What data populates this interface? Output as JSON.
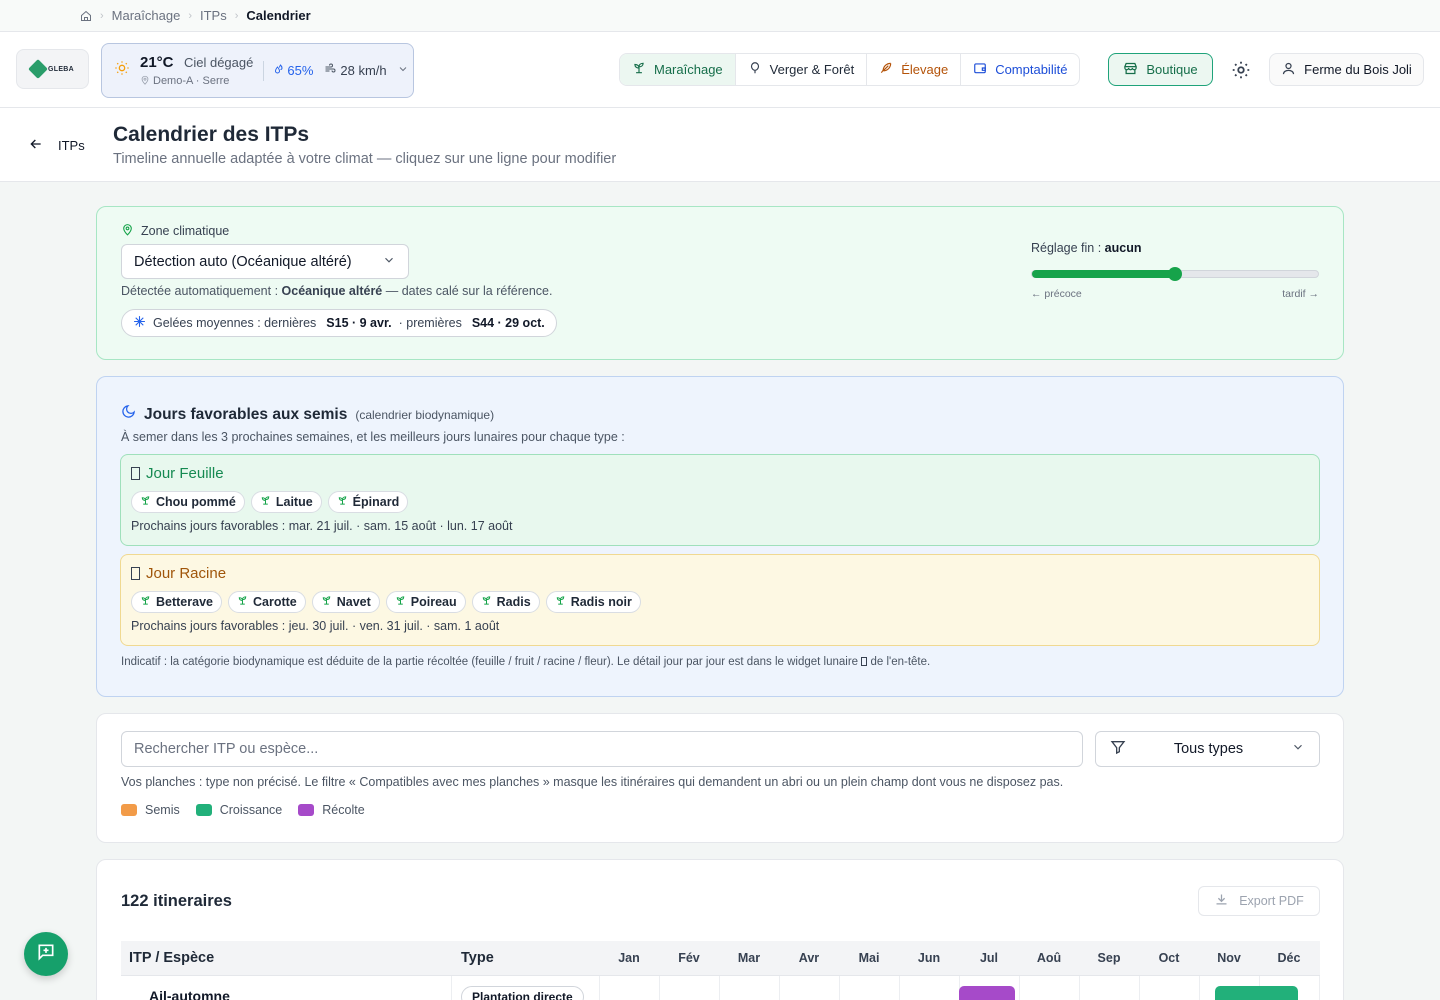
{
  "breadcrumb": {
    "items": [
      "Maraîchage",
      "ITPs"
    ],
    "current": "Calendrier"
  },
  "weather": {
    "temp": "21°C",
    "condition": "Ciel dégagé",
    "location": "Demo-A · Serre",
    "humidity": "65%",
    "wind": "28 km/h"
  },
  "logo": {
    "text": "GLEBA"
  },
  "nav": {
    "modules": [
      {
        "label": "Maraîchage",
        "icon": "sprout-icon"
      },
      {
        "label": "Verger & Forêt",
        "icon": "tree-icon"
      },
      {
        "label": "Élevage",
        "icon": "feather-icon"
      },
      {
        "label": "Comptabilité",
        "icon": "wallet-icon"
      }
    ],
    "shop": "Boutique",
    "farm": "Ferme du Bois Joli"
  },
  "page": {
    "back_label": "ITPs",
    "title": "Calendrier des ITPs",
    "subtitle": "Timeline annuelle adaptée à votre climat — cliquez sur une ligne pour modifier"
  },
  "zone": {
    "label": "Zone climatique",
    "selected": "Détection auto (Océanique altéré)",
    "detected_prefix": "Détectée automatiquement : ",
    "detected_value": "Océanique altéré",
    "detected_suffix": " — dates calé sur la référence.",
    "frost_prefix": "Gelées moyennes : dernières",
    "frost_last": "S15 · 9 avr.",
    "frost_mid": "· premières",
    "frost_first": "S44 · 29 oct.",
    "fine_label": "Réglage fin : ",
    "fine_value": "aucun",
    "fine_level": 0.5,
    "fine_left": "← précoce",
    "fine_right": "tardif →"
  },
  "lunar": {
    "title": "Jours favorables aux semis",
    "subtitle": "(calendrier biodynamique)",
    "intro": "À semer dans les 3 prochaines semaines, et les meilleurs jours lunaires pour chaque type :",
    "leaf": {
      "title": "Jour Feuille",
      "chips": [
        "Chou pommé",
        "Laitue",
        "Épinard"
      ],
      "next_prefix": "Prochains jours favorables : ",
      "next": "mar. 21 juil. · sam. 15 août · lun. 17 août"
    },
    "root": {
      "title": "Jour Racine",
      "chips": [
        "Betterave",
        "Carotte",
        "Navet",
        "Poireau",
        "Radis",
        "Radis noir"
      ],
      "next_prefix": "Prochains jours favorables : ",
      "next": "jeu. 30 juil. · ven. 31 juil. · sam. 1 août"
    },
    "note": "Indicatif : la catégorie biodynamique est déduite de la partie récoltée (feuille / fruit / racine / fleur). Le détail jour par jour est dans le widget lunaire",
    "note_end": "de l'en-tête."
  },
  "filters": {
    "search_placeholder": "Rechercher ITP ou espèce...",
    "type_value": "Tous types",
    "hint": "Vos planches : type non précisé. Le filtre « Compatibles avec mes planches » masque les itinéraires qui demandent un abri ou un plein champ dont vous ne disposez pas.",
    "legend": [
      {
        "label": "Semis",
        "color": "#f29b48"
      },
      {
        "label": "Croissance",
        "color": "#22b07a"
      },
      {
        "label": "Récolte",
        "color": "#a64ac9"
      }
    ]
  },
  "table": {
    "count": "122 itineraires",
    "export": "Export PDF",
    "col_itp": "ITP / Espèce",
    "col_type": "Type",
    "months": [
      "Jan",
      "Fév",
      "Mar",
      "Avr",
      "Mai",
      "Jun",
      "Jul",
      "Aoû",
      "Sep",
      "Oct",
      "Nov",
      "Déc"
    ],
    "rows": [
      {
        "name": "Ail-automne",
        "type": "Plantation directe"
      }
    ]
  }
}
